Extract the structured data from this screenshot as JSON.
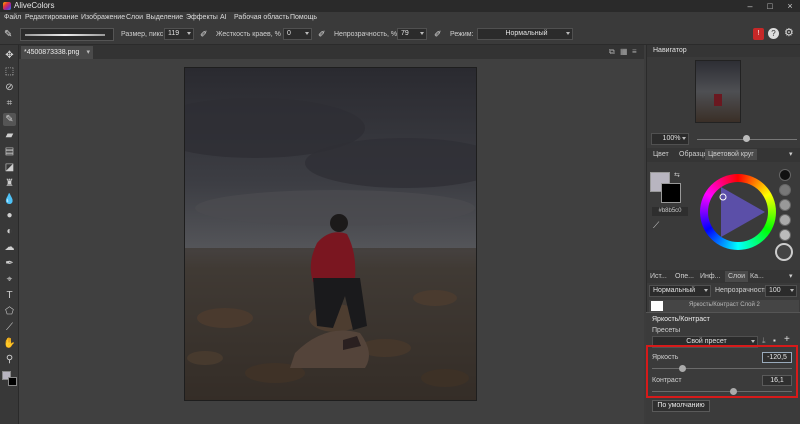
{
  "app": {
    "title": "AliveColors"
  },
  "menu": [
    "Файл",
    "Редактирование",
    "Изображение",
    "Слои",
    "Выделение",
    "Эффекты",
    "AI",
    "Рабочая область",
    "Помощь"
  ],
  "options": {
    "size_label": "Размер, пикс",
    "size_value": "119",
    "hardness_label": "Жесткость краев, %",
    "hardness_value": "0",
    "opacity_label": "Непрозрачность, %",
    "opacity_value": "79",
    "mode_label": "Режим:",
    "mode_value": "Нормальный"
  },
  "document": {
    "tab_title": "*4500873338.png"
  },
  "navigator": {
    "title": "Навигатор",
    "zoom": "100%"
  },
  "color_panel": {
    "tabs": [
      "Цвет",
      "Образцы",
      "Цветовой круг"
    ],
    "active_tab": "Цветовой круг",
    "hex": "#b8b5c0",
    "foreground": "#b8b5c0",
    "background": "#000000"
  },
  "layers_panel": {
    "tabs": [
      "Ист...",
      "Опе...",
      "Инф...",
      "Слои",
      "Ка..."
    ],
    "active_tab": "Слои",
    "blend_mode": "Нормальный",
    "opacity_label": "Непрозрачность",
    "opacity_value": "100",
    "layer_name": "Яркость/Контраст Слой 2"
  },
  "brightness_contrast": {
    "title": "Яркость/Контраст",
    "presets_label": "Пресеты",
    "preset_value": "Свой пресет",
    "brightness_label": "Яркость",
    "brightness_value": "-120,5",
    "brightness_fraction": 0.22,
    "contrast_label": "Контраст",
    "contrast_value": "16,1",
    "contrast_fraction": 0.58,
    "default_button": "По умолчанию"
  },
  "colors": {
    "accent": "#d61a1a",
    "panel": "#3a3a3a"
  }
}
